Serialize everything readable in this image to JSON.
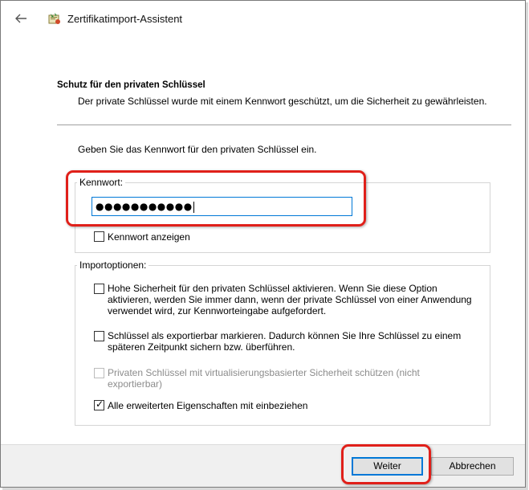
{
  "window": {
    "title": "Zertifikatimport-Assistent"
  },
  "section": {
    "heading": "Schutz für den privaten Schlüssel",
    "description": "Der private Schlüssel wurde mit einem Kennwort geschützt, um die Sicherheit zu gewährleisten."
  },
  "prompt": "Geben Sie das Kennwort für den privaten Schlüssel ein.",
  "password": {
    "label": "Kennwort:",
    "masked_value": "●●●●●●●●●●●",
    "show_label": "Kennwort anzeigen",
    "show_checked": false
  },
  "import_options": {
    "legend": "Importoptionen:",
    "options": [
      {
        "label": "Hohe Sicherheit für den privaten Schlüssel aktivieren. Wenn Sie diese Option aktivieren, werden Sie immer dann, wenn der private Schlüssel von einer Anwendung verwendet wird, zur Kennworteingabe aufgefordert.",
        "checked": false,
        "enabled": true
      },
      {
        "label": "Schlüssel als exportierbar markieren. Dadurch können Sie Ihre Schlüssel zu einem späteren Zeitpunkt sichern bzw. überführen.",
        "checked": false,
        "enabled": true
      },
      {
        "label": "Privaten Schlüssel mit virtualisierungsbasierter Sicherheit schützen (nicht exportierbar)",
        "checked": false,
        "enabled": false
      },
      {
        "label": "Alle erweiterten Eigenschaften mit einbeziehen",
        "checked": true,
        "enabled": true
      }
    ]
  },
  "buttons": {
    "next": "Weiter",
    "cancel": "Abbrechen"
  },
  "colors": {
    "highlight": "#e0201a",
    "focus": "#0078d7"
  },
  "icons": {
    "back": "back-arrow-icon",
    "app": "certificate-icon"
  }
}
